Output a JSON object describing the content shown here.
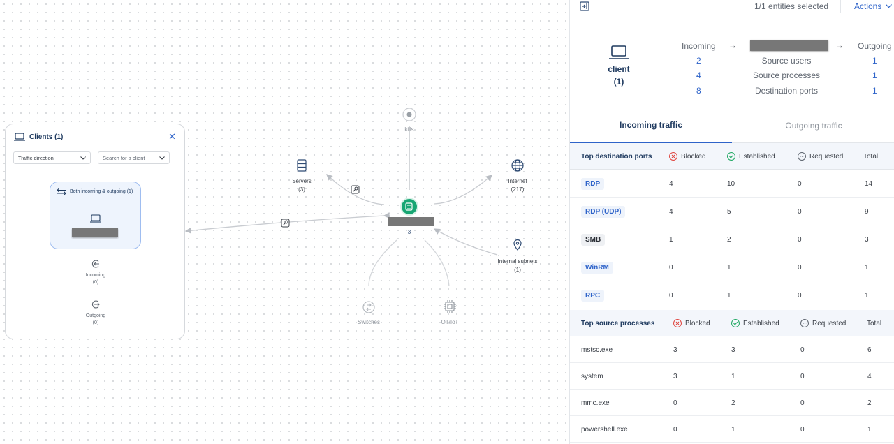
{
  "canvas": {
    "clients_panel": {
      "title": "Clients (1)",
      "close": "✕",
      "traffic_select": "Traffic direction",
      "search_select": "Search for a client",
      "group_label": "Both incoming & outgoing (1)",
      "incoming_label": "Incoming",
      "incoming_count": "(0)",
      "outgoing_label": "Outgoing",
      "outgoing_count": "(0)"
    },
    "nodes": {
      "servers": {
        "label": "Servers",
        "count": "(3)"
      },
      "kills": {
        "label": "kills"
      },
      "internet": {
        "label": "Internet",
        "count": "(217)"
      },
      "internal": {
        "label": "Internal subnets",
        "count": "(1)"
      },
      "switches": {
        "label": "Switches"
      },
      "otiot": {
        "label": "OT/IoT"
      },
      "center_count": "3"
    }
  },
  "panel": {
    "selection_text": "1/1 entities selected",
    "actions_label": "Actions",
    "summary": {
      "client_name": "client",
      "client_count": "(1)",
      "incoming_label": "Incoming",
      "outgoing_label": "Outgoing",
      "arrow": "→",
      "rows": [
        {
          "in": "2",
          "label": "Source users",
          "out": "1"
        },
        {
          "in": "4",
          "label": "Source processes",
          "out": "1"
        },
        {
          "in": "8",
          "label": "Destination ports",
          "out": "1"
        }
      ]
    },
    "tabs": {
      "incoming": "Incoming traffic",
      "outgoing": "Outgoing traffic"
    },
    "ports": {
      "header": {
        "name": "Top destination ports",
        "blocked": "Blocked",
        "established": "Established",
        "requested": "Requested",
        "total": "Total"
      },
      "rows": [
        {
          "name": "RDP",
          "blocked": "4",
          "established": "10",
          "requested": "0",
          "total": "14"
        },
        {
          "name": "RDP (UDP)",
          "blocked": "4",
          "established": "5",
          "requested": "0",
          "total": "9"
        },
        {
          "name": "SMB",
          "blocked": "1",
          "established": "2",
          "requested": "0",
          "total": "3"
        },
        {
          "name": "WinRM",
          "blocked": "0",
          "established": "1",
          "requested": "0",
          "total": "1"
        },
        {
          "name": "RPC",
          "blocked": "0",
          "established": "1",
          "requested": "0",
          "total": "1"
        }
      ]
    },
    "processes": {
      "header": {
        "name": "Top source processes",
        "blocked": "Blocked",
        "established": "Established",
        "requested": "Requested",
        "total": "Total"
      },
      "rows": [
        {
          "name": "mstsc.exe",
          "blocked": "3",
          "established": "3",
          "requested": "0",
          "total": "6"
        },
        {
          "name": "system",
          "blocked": "3",
          "established": "1",
          "requested": "0",
          "total": "4"
        },
        {
          "name": "mmc.exe",
          "blocked": "0",
          "established": "2",
          "requested": "0",
          "total": "2"
        },
        {
          "name": "powershell.exe",
          "blocked": "0",
          "established": "1",
          "requested": "0",
          "total": "1"
        }
      ]
    }
  },
  "colors": {
    "accent": "#2e63c9",
    "center_node": "#17a673",
    "blocked": "#e0443e",
    "established": "#1fa862",
    "requested": "#5f6670"
  }
}
